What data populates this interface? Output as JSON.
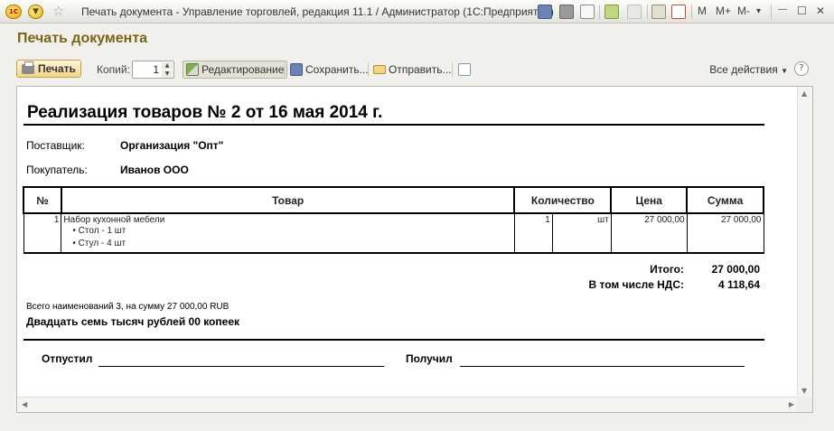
{
  "window": {
    "title": "Печать документа - Управление торговлей, редакция 11.1 / Администратор  (1С:Предприятие)",
    "logo_text": "1С",
    "mem_buttons": [
      "M",
      "M+",
      "M-"
    ]
  },
  "form": {
    "title": "Печать документа"
  },
  "toolbar": {
    "print_label": "Печать",
    "copies_label": "Копий:",
    "copies_value": "1",
    "edit_label": "Редактирование",
    "save_label": "Сохранить...",
    "send_label": "Отправить...",
    "all_actions_label": "Все действия",
    "help_label": "?"
  },
  "document": {
    "heading": "Реализация товаров № 2 от 16 мая 2014 г.",
    "supplier_label": "Поставщик:",
    "supplier_value": "Организация \"Опт\"",
    "buyer_label": "Покупатель:",
    "buyer_value": "Иванов ООО",
    "columns": {
      "num": "№",
      "item": "Товар",
      "qty": "Количество",
      "price": "Цена",
      "sum": "Сумма"
    },
    "rows": [
      {
        "num": "1",
        "item": "Набор кухонной мебели",
        "sub_items": [
          "• Стол - 1 шт",
          "• Стул - 4 шт"
        ],
        "qty": "1",
        "unit": "шт",
        "price": "27 000,00",
        "sum": "27 000,00"
      }
    ],
    "total_label": "Итого:",
    "total_value": "27 000,00",
    "vat_label": "В том числе НДС:",
    "vat_value": "4 118,64",
    "summary_line": "Всего наименований 3, на сумму 27 000,00 RUB",
    "amount_words": "Двадцать семь тысяч рублей 00 копеек",
    "released_label": "Отпустил",
    "received_label": "Получил"
  },
  "colors": {
    "form_title": "#7a6516",
    "print_button": "#f0d68c",
    "background": "#f1f0ec"
  }
}
